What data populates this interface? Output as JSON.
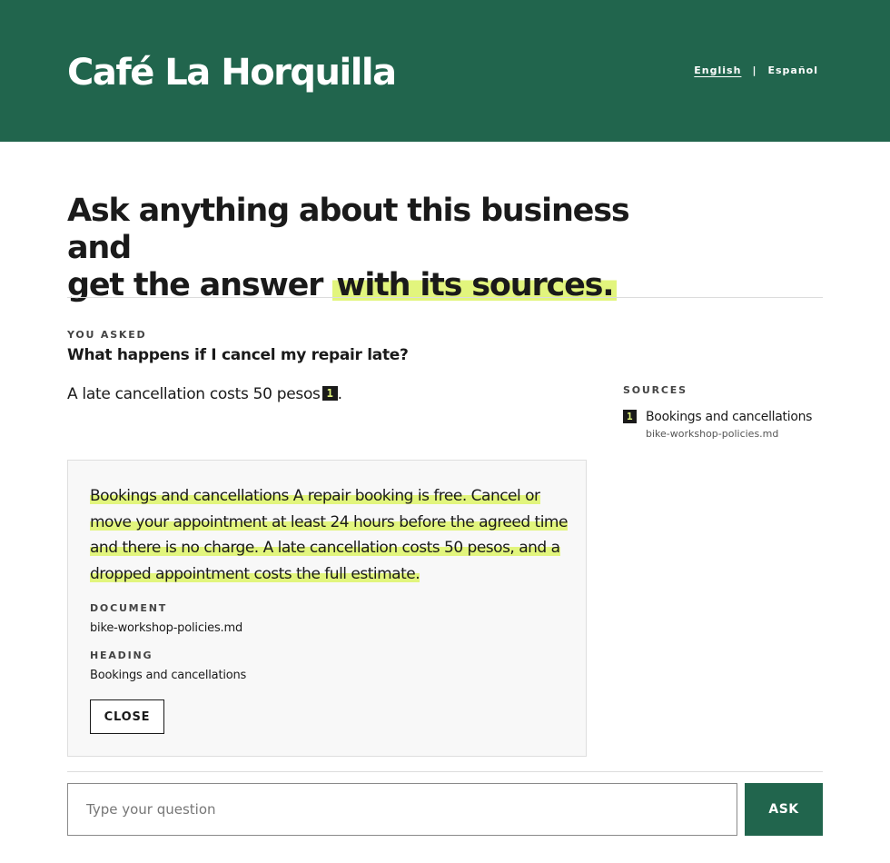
{
  "header": {
    "brand": "Café La Horquilla",
    "lang_english": "English",
    "lang_separator": "|",
    "lang_spanish": "Español"
  },
  "hero": {
    "line1": "Ask anything about this business and",
    "line2_plain": "get the answer",
    "line2_highlight": "with its sources."
  },
  "conversation": {
    "asked_label": "YOU ASKED",
    "question": "What happens if I cancel my repair late?",
    "answer_text": "A late cancellation costs 50 pesos",
    "answer_cite": "1",
    "answer_end": "."
  },
  "sources": {
    "label": "SOURCES",
    "items": [
      {
        "number": "1",
        "title": "Bookings and cancellations",
        "file": "bike-workshop-policies.md"
      }
    ]
  },
  "excerpt_panel": {
    "text": "Bookings and cancellations A repair booking is free. Cancel or move your appointment at least 24 hours before the agreed time and there is no charge. A late cancellation costs 50 pesos, and a dropped appointment costs the full estimate.",
    "document_label": "DOCUMENT",
    "document_value": "bike-workshop-policies.md",
    "heading_label": "HEADING",
    "heading_value": "Bookings and cancellations",
    "close_label": "CLOSE"
  },
  "ask_bar": {
    "placeholder": "Type your question",
    "value": "",
    "button_label": "ASK"
  },
  "colors": {
    "brand_green": "#21654d",
    "highlight": "#e2f57d",
    "ink": "#1a1a1a"
  }
}
